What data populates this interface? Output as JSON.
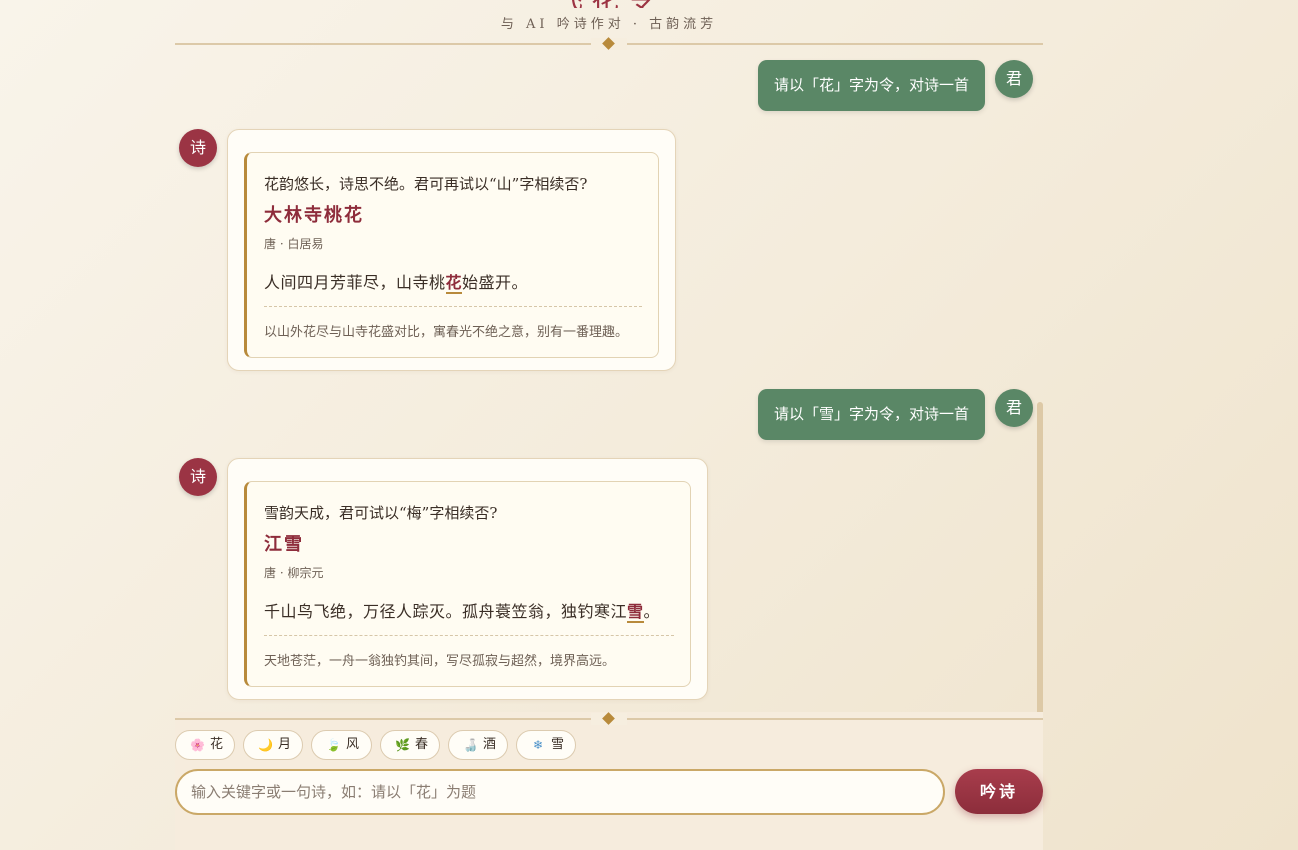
{
  "header": {
    "title": "飞花令",
    "subtitle": "与 AI 吟诗作对 · 古韵流芳"
  },
  "avatars": {
    "user": "君",
    "ai": "诗"
  },
  "messages": [
    {
      "role": "user",
      "text": "请以「花」字为令，对诗一首"
    },
    {
      "role": "ai",
      "intro": "花韵悠长，诗思不绝。君可再试以“山”字相续否?",
      "poem_title": "大林寺桃花",
      "author": "唐 · 白居易",
      "line_before": "人间四月芳菲尽，山寺桃",
      "keyword": "花",
      "line_after": "始盛开。",
      "note": "以山外花尽与山寺花盛对比，寓春光不绝之意，别有一番理趣。"
    },
    {
      "role": "user",
      "text": "请以「雪」字为令，对诗一首"
    },
    {
      "role": "ai",
      "intro": "雪韵天成，君可试以“梅”字相续否?",
      "poem_title": "江雪",
      "author": "唐 · 柳宗元",
      "line_before": "千山鸟飞绝，万径人踪灭。孤舟蓑笠翁，独钓寒江",
      "keyword": "雪",
      "line_after": "。",
      "note": "天地苍茫，一舟一翁独钓其间，写尽孤寂与超然，境界高远。"
    }
  ],
  "keywords": [
    {
      "icon": "🌸",
      "label": "花",
      "icon_name": "blossom-icon"
    },
    {
      "icon": "🌙",
      "label": "月",
      "icon_name": "moon-icon"
    },
    {
      "icon": "🍃",
      "label": "风",
      "icon_name": "leaf-icon"
    },
    {
      "icon": "🌿",
      "label": "春",
      "icon_name": "herb-icon"
    },
    {
      "icon": "🍶",
      "label": "酒",
      "icon_name": "sake-icon"
    },
    {
      "icon": "❄",
      "label": "雪",
      "icon_name": "snowflake-icon"
    }
  ],
  "input": {
    "placeholder": "输入关键字或一句诗，如：请以「花」为题",
    "value": ""
  },
  "send_label": "吟诗",
  "colors": {
    "user_green": "#5a8766",
    "ai_red": "#9b3444",
    "accent_gold": "#b88a3b",
    "send_red": "#8c2d3b"
  }
}
